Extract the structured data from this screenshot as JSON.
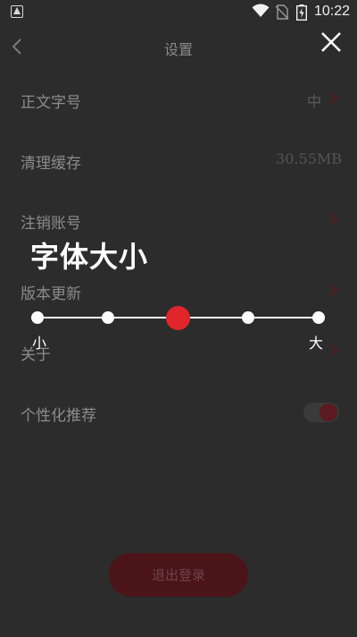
{
  "status_bar": {
    "time": "10:22",
    "icons": [
      "notification-icon",
      "wifi-icon",
      "no-sim-icon",
      "battery-icon"
    ]
  },
  "header": {
    "title": "设置",
    "back_icon": "chevron-left-icon",
    "close_icon": "close-icon"
  },
  "settings": {
    "items": [
      {
        "label": "正文字号",
        "value": "中",
        "chevron": true
      },
      {
        "label": "清理缓存",
        "value": "30.55MB",
        "chevron": false
      },
      {
        "label": "注销账号",
        "value": "",
        "chevron": true
      },
      {
        "label": "版本更新",
        "value": "",
        "chevron": true
      },
      {
        "label": "关于",
        "value": "",
        "chevron": true
      },
      {
        "label": "个性化推荐",
        "value": "",
        "toggle": true
      }
    ]
  },
  "logout": {
    "label": "退出登录"
  },
  "font_size_overlay": {
    "title": "字体大小",
    "min_label": "小",
    "max_label": "大",
    "stops": 5,
    "selected_index": 2
  },
  "colors": {
    "accent": "#e0262b",
    "background": "#2c2c2c",
    "row_label": "#8c8c8c",
    "chevron": "#5b1a1f"
  }
}
